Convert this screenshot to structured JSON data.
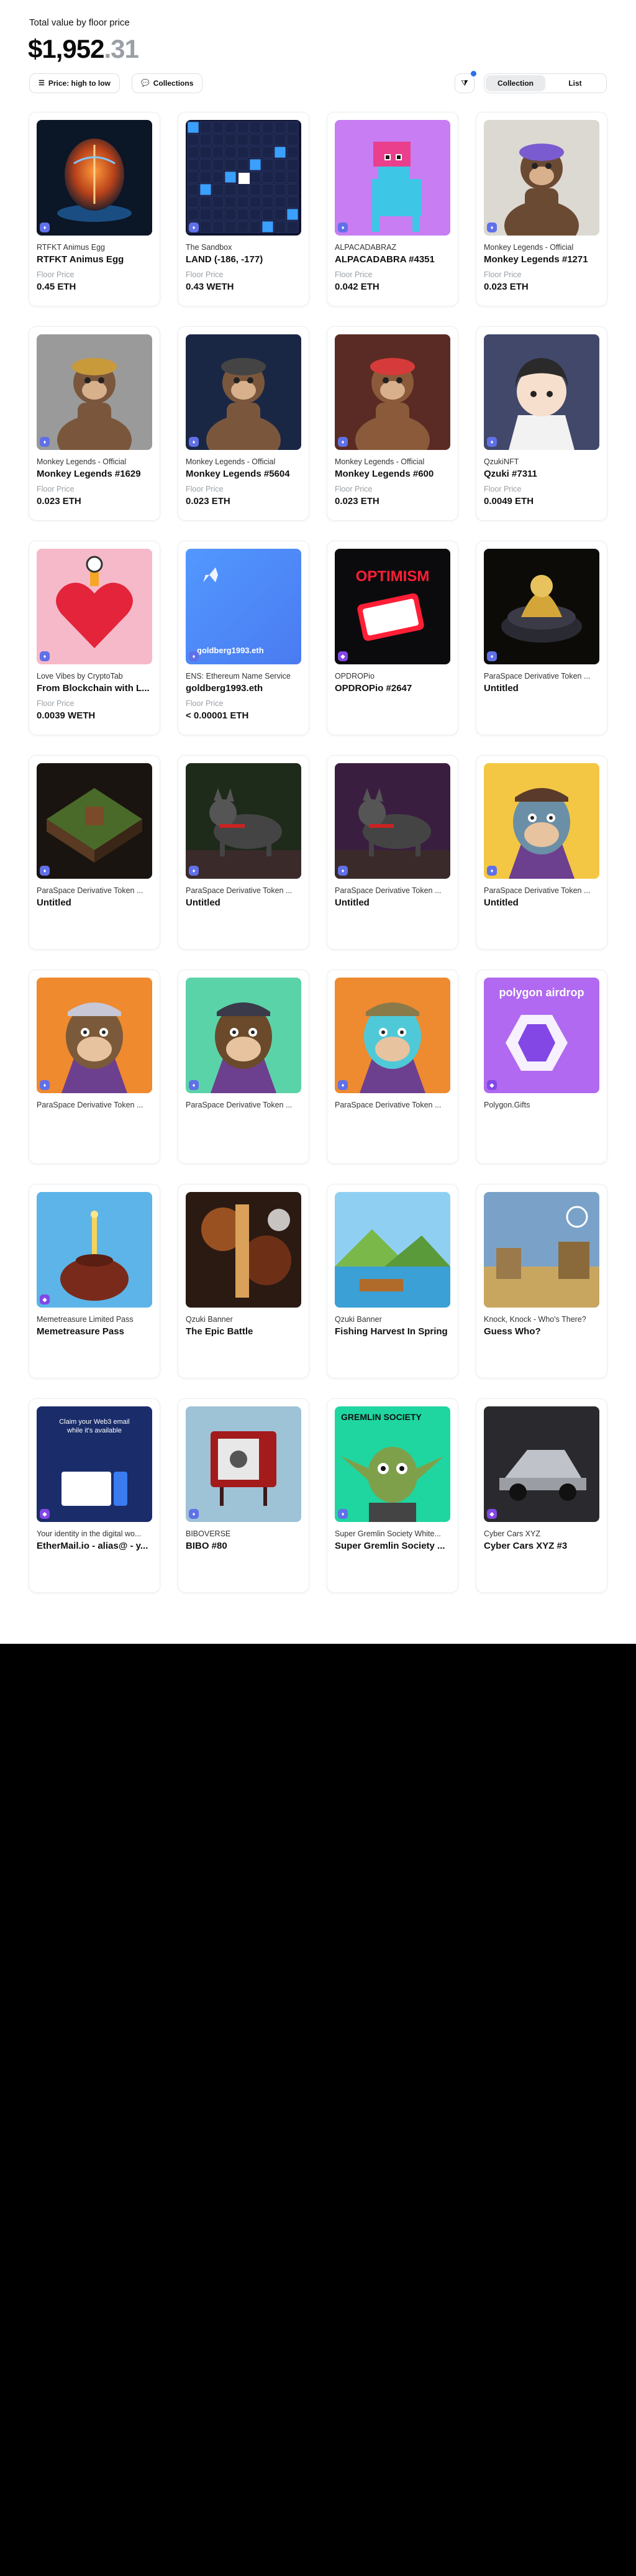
{
  "header": {
    "total_label": "Total value by floor price",
    "total_main": "$1,952",
    "total_cents": ".31"
  },
  "toolbar": {
    "sort_label": "Price: high to low",
    "sort_icon": "sort-lines-icon",
    "collections_label": "Collections",
    "collections_icon": "chat-bubble-icon",
    "filter_icon": "filter-icon",
    "view_collection": "Collection",
    "view_list": "List"
  },
  "cards": [
    {
      "collection": "RTFKT Animus Egg",
      "name": "RTFKT Animus Egg",
      "floor_label": "Floor Price",
      "floor": "0.45 ETH",
      "chain": "ethereum-icon",
      "image": "egg"
    },
    {
      "collection": "The Sandbox",
      "name": "LAND (-186, -177)",
      "floor_label": "Floor Price",
      "floor": "0.43 WETH",
      "chain": "ethereum-icon",
      "image": "sandbox"
    },
    {
      "collection": "ALPACADABRAZ",
      "name": "ALPACADABRA #4351",
      "floor_label": "Floor Price",
      "floor": "0.042 ETH",
      "chain": "ethereum-icon",
      "image": "alpaca"
    },
    {
      "collection": "Monkey Legends - Official",
      "name": "Monkey Legends #1271",
      "floor_label": "Floor Price",
      "floor": "0.023 ETH",
      "chain": "ethereum-icon",
      "image": "monkey-tan"
    },
    {
      "collection": "Monkey Legends - Official",
      "name": "Monkey Legends #1629",
      "floor_label": "Floor Price",
      "floor": "0.023 ETH",
      "chain": "ethereum-icon",
      "image": "monkey-gray"
    },
    {
      "collection": "Monkey Legends - Official",
      "name": "Monkey Legends #5604",
      "floor_label": "Floor Price",
      "floor": "0.023 ETH",
      "chain": "ethereum-icon",
      "image": "monkey-navy"
    },
    {
      "collection": "Monkey Legends - Official",
      "name": "Monkey Legends #600",
      "floor_label": "Floor Price",
      "floor": "0.023 ETH",
      "chain": "ethereum-icon",
      "image": "monkey-brown"
    },
    {
      "collection": "QzukiNFT",
      "name": "Qzuki #7311",
      "floor_label": "Floor Price",
      "floor": "0.0049 ETH",
      "chain": "ethereum-icon",
      "image": "qzuki"
    },
    {
      "collection": "Love Vibes by CryptoTab",
      "name": "From Blockchain with L...",
      "floor_label": "Floor Price",
      "floor": "0.0039 WETH",
      "chain": "ethereum-icon",
      "image": "love"
    },
    {
      "collection": "ENS: Ethereum Name Service",
      "name": "goldberg1993.eth",
      "floor_label": "Floor Price",
      "floor": "< 0.00001 ETH",
      "chain": "ethereum-icon",
      "image": "ens",
      "image_text": "goldberg1993.eth"
    },
    {
      "collection": "OPDROPio",
      "name": "OPDROPio #2647",
      "floor_label": "",
      "floor": "",
      "chain": "polygon-icon",
      "image": "optimism",
      "image_text": "OPTIMISM"
    },
    {
      "collection": "ParaSpace Derivative Token ...",
      "name": "Untitled",
      "floor_label": "",
      "floor": "",
      "chain": "ethereum-icon",
      "image": "paraspace-gold"
    },
    {
      "collection": "ParaSpace Derivative Token ...",
      "name": "Untitled",
      "floor_label": "",
      "floor": "",
      "chain": "ethereum-icon",
      "image": "paraspace-iso"
    },
    {
      "collection": "ParaSpace Derivative Token ...",
      "name": "Untitled",
      "floor_label": "",
      "floor": "",
      "chain": "ethereum-icon",
      "image": "paraspace-dog1"
    },
    {
      "collection": "ParaSpace Derivative Token ...",
      "name": "Untitled",
      "floor_label": "",
      "floor": "",
      "chain": "ethereum-icon",
      "image": "paraspace-dog2"
    },
    {
      "collection": "ParaSpace Derivative Token ...",
      "name": "Untitled",
      "floor_label": "",
      "floor": "",
      "chain": "ethereum-icon",
      "image": "ape-yellow"
    },
    {
      "collection": "ParaSpace Derivative Token ...",
      "name": "",
      "floor_label": "",
      "floor": "",
      "chain": "ethereum-icon",
      "image": "ape-orange"
    },
    {
      "collection": "ParaSpace Derivative Token ...",
      "name": "",
      "floor_label": "",
      "floor": "",
      "chain": "ethereum-icon",
      "image": "ape-green"
    },
    {
      "collection": "ParaSpace Derivative Token ...",
      "name": "",
      "floor_label": "",
      "floor": "",
      "chain": "ethereum-icon",
      "image": "ape-orange2"
    },
    {
      "collection": "Polygon.Gifts",
      "name": "",
      "floor_label": "",
      "floor": "",
      "chain": "polygon-icon",
      "image": "polygon",
      "image_text": "polygon airdrop"
    },
    {
      "collection": "Memetreasure Limited Pass",
      "name": "Memetreasure Pass",
      "floor_label": "",
      "floor": "",
      "chain": "polygon-icon",
      "image": "meme"
    },
    {
      "collection": "Qzuki Banner",
      "name": "The Epic Battle",
      "floor_label": "",
      "floor": "",
      "chain": "",
      "image": "battle"
    },
    {
      "collection": "Qzuki Banner",
      "name": "Fishing Harvest In Spring",
      "floor_label": "",
      "floor": "",
      "chain": "",
      "image": "fishing"
    },
    {
      "collection": "Knock, Knock - Who's There?",
      "name": "Guess Who?",
      "floor_label": "",
      "floor": "",
      "chain": "",
      "image": "guess"
    },
    {
      "collection": "Your identity in the digital wo...",
      "name": "EtherMail.io - alias@ - y...",
      "floor_label": "",
      "floor": "",
      "chain": "polygon-icon",
      "image": "ethermail",
      "image_text": "Claim your Web3 email while it's available"
    },
    {
      "collection": "BIBOVERSE",
      "name": "BIBO #80",
      "floor_label": "",
      "floor": "",
      "chain": "ethereum-icon",
      "image": "tv"
    },
    {
      "collection": "Super Gremlin Society White...",
      "name": "Super Gremlin Society ...",
      "floor_label": "",
      "floor": "",
      "chain": "ethereum-icon",
      "image": "gremlin",
      "image_text": "GREMLIN SOCIETY"
    },
    {
      "collection": "Cyber Cars XYZ",
      "name": "Cyber Cars XYZ #3",
      "floor_label": "",
      "floor": "",
      "chain": "polygon-icon",
      "image": "car"
    }
  ]
}
